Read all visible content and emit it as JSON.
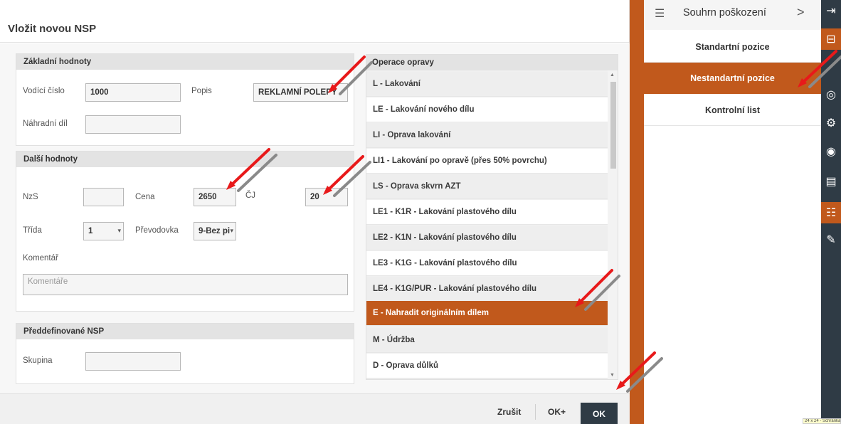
{
  "dialog": {
    "title": "Vložit novou NSP",
    "basic": {
      "header": "Základní hodnoty",
      "vodici_cislo_label": "Vodící číslo",
      "vodici_cislo_value": "1000",
      "popis_label": "Popis",
      "popis_value": "REKLAMNÍ POLEPY",
      "nahradni_dil_label": "Náhradní díl",
      "nahradni_dil_value": ""
    },
    "more": {
      "header": "Další hodnoty",
      "nzs_label": "NzS",
      "nzs_value": "",
      "cena_label": "Cena",
      "cena_value": "2650",
      "cj_label": "ČJ",
      "cj_value": "20",
      "trida_label": "Třída",
      "trida_value": "1",
      "prevodovka_label": "Převodovka",
      "prevodovka_value": "9-Bez pi",
      "komentar_label": "Komentář",
      "komentar_placeholder": "Komentáře"
    },
    "predefined": {
      "header": "Předdefinované NSP",
      "skupina_label": "Skupina",
      "skupina_value": ""
    },
    "operations": {
      "header": "Operace opravy",
      "items": [
        "L - Lakování",
        "LE - Lakování nového dílu",
        "LI - Oprava lakování",
        "LI1 - Lakování po opravě (přes 50% povrchu)",
        "LS - Oprava skvrn AZT",
        "LE1 - K1R - Lakování plastového dílu",
        "LE2 - K1N - Lakování plastového dílu",
        "LE3 - K1G - Lakování plastového dílu",
        "LE4 - K1G/PUR - Lakování plastového dílu",
        "E - Nahradit originálním dílem",
        "M - Údržba",
        "D - Oprava důlků"
      ],
      "selected_index": 9
    },
    "footer": {
      "cancel_label": "Zrušit",
      "ok_plus_label": "OK+",
      "ok_label": "OK"
    }
  },
  "panel": {
    "header_label": "Souhrn poškození",
    "items": [
      "Standartní pozice",
      "Nestandartní pozice",
      "Kontrolní list"
    ],
    "active_index": 1
  },
  "status_tip": "24 x 24 - Schránka",
  "colors": {
    "accent": "#c1591c",
    "dark": "#2f3b45",
    "arrow_red": "#e8191a",
    "arrow_gray": "#8a8a8a"
  }
}
